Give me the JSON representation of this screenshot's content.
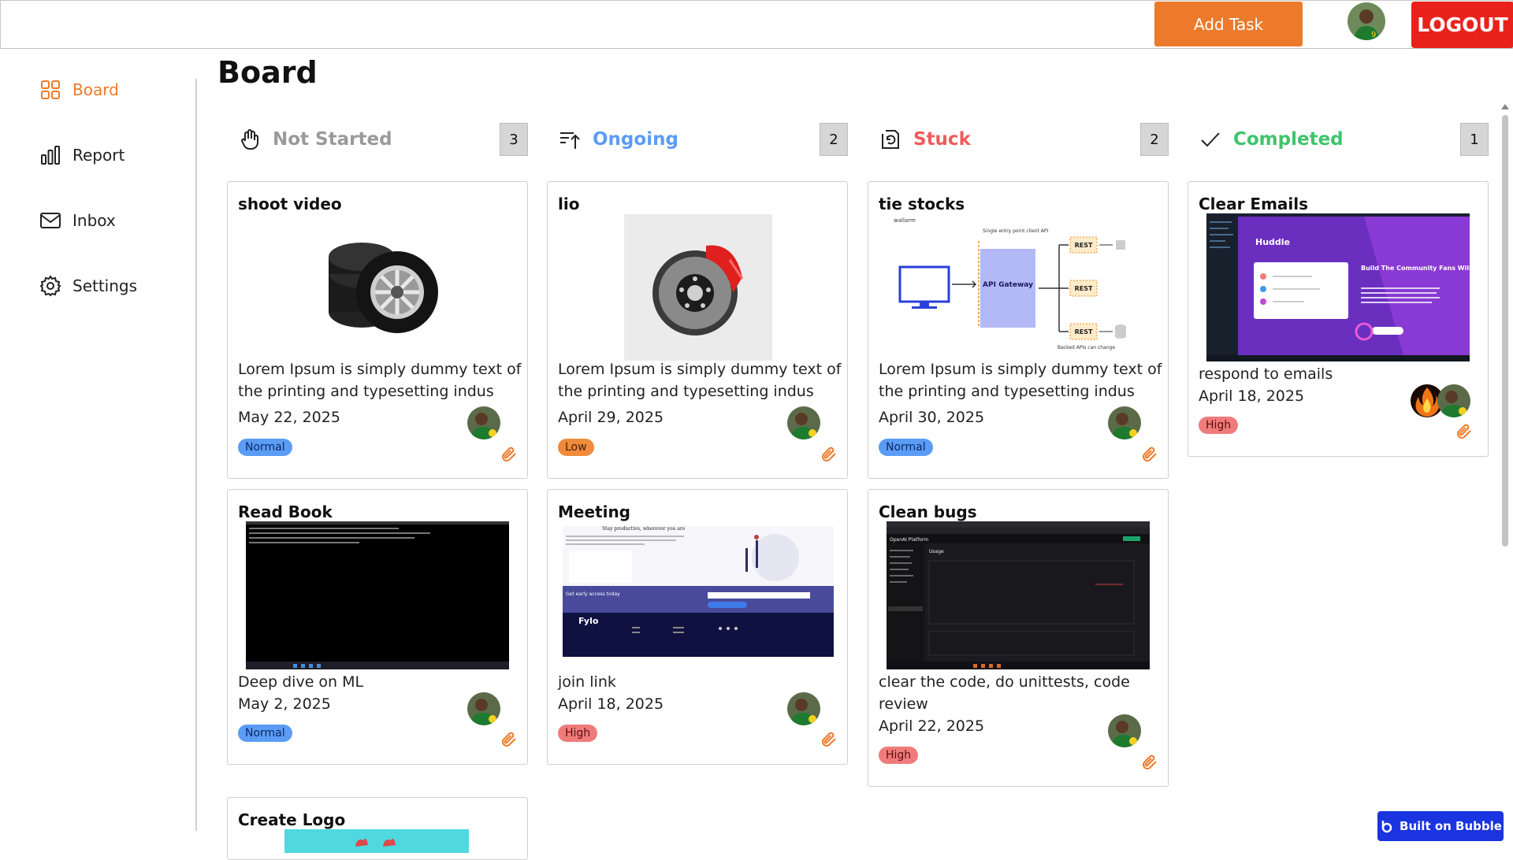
{
  "header": {
    "add_task_label": "Add Task",
    "logout_label": "LOGOUT"
  },
  "sidebar": {
    "items": [
      {
        "label": "Board",
        "icon": "grid-icon",
        "active": true
      },
      {
        "label": "Report",
        "icon": "bar-chart-icon"
      },
      {
        "label": "Inbox",
        "icon": "mail-icon"
      },
      {
        "label": "Settings",
        "icon": "gear-icon"
      }
    ]
  },
  "main": {
    "title": "Board",
    "columns": [
      {
        "title": "Not Started",
        "count": "3",
        "color": "#9a9a9a",
        "icon": "hand-icon"
      },
      {
        "title": "Ongoing",
        "count": "2",
        "color": "#5b9cf5",
        "icon": "sort-up-icon"
      },
      {
        "title": "Stuck",
        "count": "2",
        "color": "#f05a5a",
        "icon": "stuck-icon"
      },
      {
        "title": "Completed",
        "count": "1",
        "color": "#3fc46c",
        "icon": "check-icon"
      }
    ],
    "cards": {
      "shoot_video": {
        "title": "shoot video",
        "desc": "Lorem Ipsum is simply dummy text of the printing and typesetting indus",
        "date": "May 22, 2025",
        "priority": "Normal"
      },
      "read_book": {
        "title": "Read Book",
        "desc": "Deep dive on ML",
        "date": "May 2, 2025",
        "priority": "Normal"
      },
      "create_logo": {
        "title": "Create Logo"
      },
      "lio": {
        "title": "lio",
        "desc": "Lorem Ipsum is simply dummy text of the printing and typesetting indus",
        "date": "April 29, 2025",
        "priority": "Low"
      },
      "meeting": {
        "title": "Meeting",
        "desc": "join link",
        "date": "April 18, 2025",
        "priority": "High"
      },
      "tie_stocks": {
        "title": "tie stocks",
        "desc": "Lorem Ipsum is simply dummy text of the printing and typesetting indus",
        "date": "April 30, 2025",
        "priority": "Normal"
      },
      "clean_bugs": {
        "title": "Clean bugs",
        "desc": "clear the code, do unittests, code review",
        "date": "April 22, 2025",
        "priority": "High"
      },
      "clear_emails": {
        "title": "Clear Emails",
        "desc": "respond to emails",
        "date": "April 18, 2025",
        "priority": "High"
      }
    },
    "images": {
      "wallarm": "wallarm",
      "api_gateway": "API Gateway",
      "rest": "REST",
      "single_entry": "Single entry point client API",
      "backed": "Backed APIs can change",
      "huddle": "Huddle",
      "huddle_headline": "Build The Community Fans Will Love",
      "fylo": "Fylo",
      "fylo_tagline": "Stay productive, wherever you are",
      "fylo_early": "Get early access today",
      "openai": "OpenAI Platform",
      "usage": "Usage"
    }
  },
  "footer": {
    "bubble_label": "Built on Bubble"
  }
}
